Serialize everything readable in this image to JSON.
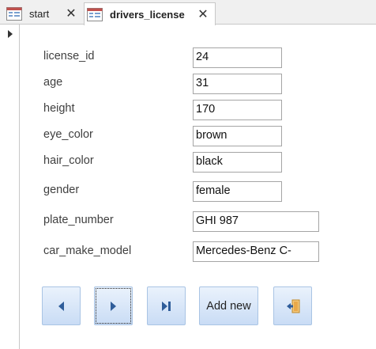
{
  "tabs": [
    {
      "label": "start",
      "active": false,
      "icon": "form-icon"
    },
    {
      "label": "drivers_license",
      "active": true,
      "icon": "form-icon"
    }
  ],
  "close_glyph": "✕",
  "fields": [
    {
      "label": "license_id",
      "value": "24"
    },
    {
      "label": "age",
      "value": "31"
    },
    {
      "label": "height",
      "value": "170"
    },
    {
      "label": "eye_color",
      "value": "brown"
    },
    {
      "label": "hair_color",
      "value": "black"
    },
    {
      "label": "gender",
      "value": "female"
    },
    {
      "label": "plate_number",
      "value": "GHI 987"
    },
    {
      "label": "car_make_model",
      "value": "Mercedes-Benz C-"
    }
  ],
  "buttons": {
    "previous": {
      "icon": "previous-record-icon"
    },
    "next": {
      "icon": "next-record-icon"
    },
    "last": {
      "icon": "last-record-icon"
    },
    "add_new": {
      "label": "Add new"
    },
    "close": {
      "icon": "close-form-icon"
    }
  },
  "colors": {
    "button_gradient_top": "#eaf2fc",
    "button_gradient_bottom": "#c9dcf5",
    "button_icon": "#2f5d9a",
    "tab_icon_red": "#c0504d"
  }
}
